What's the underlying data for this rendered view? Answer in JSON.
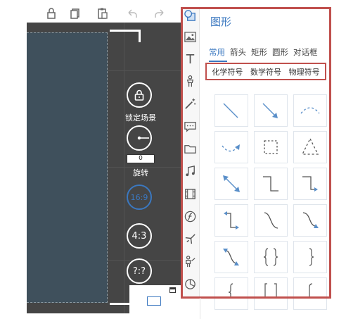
{
  "workspace": {
    "lock_label": "锁定场景",
    "rotate_label": "旋转",
    "rotate_value": "0",
    "ratio_16_9": "16:9",
    "ratio_4_3": "4:3",
    "ratio_custom": "?:?"
  },
  "panel": {
    "title": "图形",
    "tabs": [
      "常用",
      "箭头",
      "矩形",
      "圆形",
      "对话框"
    ],
    "active_tab": "常用",
    "sub_tabs": [
      "化学符号",
      "数学符号",
      "物理符号"
    ]
  },
  "sidebar_icons": [
    "shapes-icon",
    "image-icon",
    "text-icon",
    "character-icon",
    "magic-wand-icon",
    "speech-bubble-icon",
    "folder-icon",
    "music-icon",
    "film-icon",
    "flash-icon",
    "airplane-icon",
    "presenter-icon",
    "pie-chart-icon"
  ],
  "toolbar_icons": [
    "lock-icon",
    "copy-icon",
    "paste-icon",
    "undo-icon",
    "redo-icon"
  ],
  "colors": {
    "accent": "#3b78c0",
    "highlight": "#c0504d",
    "canvas": "#3f505c",
    "workspace": "#454545"
  }
}
